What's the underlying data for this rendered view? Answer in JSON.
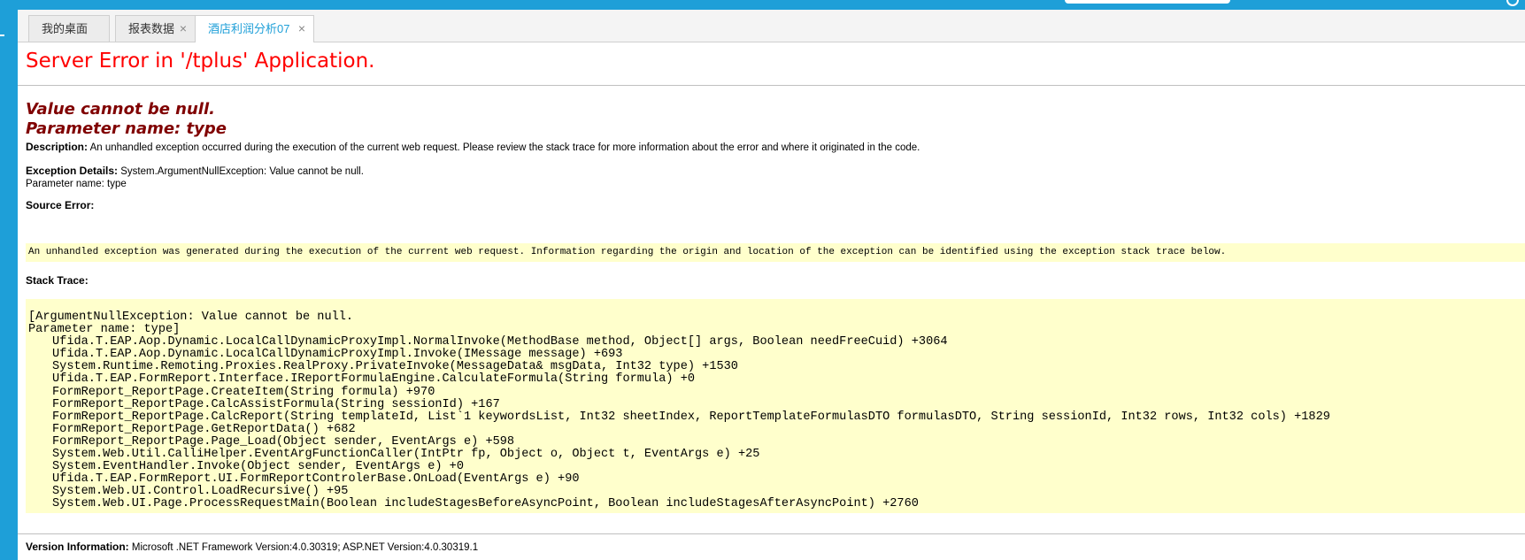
{
  "tabs": [
    {
      "label": "我的桌面",
      "closable": false,
      "active": false
    },
    {
      "label": "报表数据",
      "closable": true,
      "active": false
    },
    {
      "label": "酒店利润分析07",
      "closable": true,
      "active": true
    }
  ],
  "close_glyph": "×",
  "error": {
    "title": "Server Error in '/tplus' Application.",
    "message_line1": "Value cannot be null.",
    "message_line2": "Parameter name: type",
    "description_label": "Description:",
    "description_text": "An unhandled exception occurred during the execution of the current web request. Please review the stack trace for more information about the error and where it originated in the code.",
    "exception_label": "Exception Details:",
    "exception_text": "System.ArgumentNullException: Value cannot be null.",
    "exception_text2": "Parameter name: type",
    "source_label": "Source Error:",
    "source_text": "An unhandled exception was generated during the execution of the current web request. Information regarding the origin and location of the exception can be identified using the exception stack trace below.",
    "stack_label": "Stack Trace:",
    "stack_header1": "[ArgumentNullException: Value cannot be null.",
    "stack_header2": "Parameter name: type]",
    "stack_lines": [
      "Ufida.T.EAP.Aop.Dynamic.LocalCallDynamicProxyImpl.NormalInvoke(MethodBase method, Object[] args, Boolean needFreeCuid) +3064",
      "Ufida.T.EAP.Aop.Dynamic.LocalCallDynamicProxyImpl.Invoke(IMessage message) +693",
      "System.Runtime.Remoting.Proxies.RealProxy.PrivateInvoke(MessageData& msgData, Int32 type) +1530",
      "Ufida.T.EAP.FormReport.Interface.IReportFormulaEngine.CalculateFormula(String formula) +0",
      "FormReport_ReportPage.CreateItem(String formula) +970",
      "FormReport_ReportPage.CalcAssistFormula(String sessionId) +167",
      "FormReport_ReportPage.CalcReport(String templateId, List`1 keywordsList, Int32 sheetIndex, ReportTemplateFormulasDTO formulasDTO, String sessionId, Int32 rows, Int32 cols) +1829",
      "FormReport_ReportPage.GetReportData() +682",
      "FormReport_ReportPage.Page_Load(Object sender, EventArgs e) +598",
      "System.Web.Util.CalliHelper.EventArgFunctionCaller(IntPtr fp, Object o, Object t, EventArgs e) +25",
      "System.EventHandler.Invoke(Object sender, EventArgs e) +0",
      "Ufida.T.EAP.FormReport.UI.FormReportControlerBase.OnLoad(EventArgs e) +90",
      "System.Web.UI.Control.LoadRecursive() +95",
      "System.Web.UI.Page.ProcessRequestMain(Boolean includeStagesBeforeAsyncPoint, Boolean includeStagesAfterAsyncPoint) +2760"
    ],
    "version_label": "Version Information:",
    "version_text": "Microsoft .NET Framework Version:4.0.30319; ASP.NET Version:4.0.30319.1"
  },
  "colors": {
    "brand": "#1e9fd8",
    "error_title": "#ff0000",
    "error_message": "#800000",
    "code_bg": "#ffffcc"
  }
}
